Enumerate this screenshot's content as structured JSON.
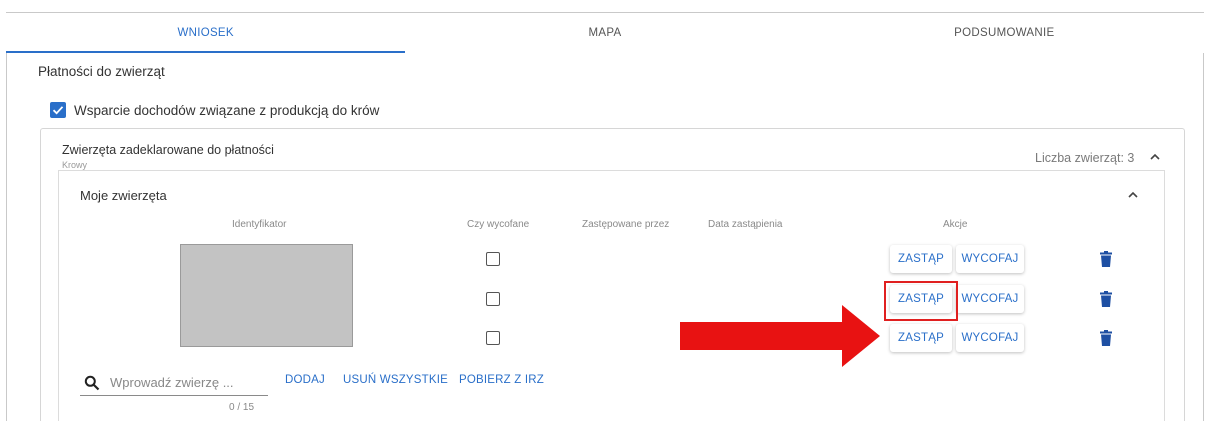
{
  "tabs": [
    {
      "label": "WNIOSEK",
      "active": true
    },
    {
      "label": "MAPA",
      "active": false
    },
    {
      "label": "PODSUMOWANIE",
      "active": false
    }
  ],
  "section": {
    "title": "Płatności do zwierząt"
  },
  "support_checkbox": {
    "label": "Wsparcie dochodów związane z produkcją do krów",
    "checked": true
  },
  "declared": {
    "title": "Zwierzęta zadeklarowane do płatności",
    "subtitle": "Krowy",
    "count_label": "Liczba zwierząt: 3"
  },
  "my_animals": {
    "title": "Moje zwierzęta",
    "columns": [
      "Identyfikator",
      "Czy wycofane",
      "Zastępowane przez",
      "Data zastąpienia",
      "Akcje"
    ],
    "rows": [
      {
        "withdrawn": false,
        "replace_label": "ZASTĄP",
        "withdraw_label": "WYCOFAJ"
      },
      {
        "withdrawn": false,
        "replace_label": "ZASTĄP",
        "withdraw_label": "WYCOFAJ"
      },
      {
        "withdrawn": false,
        "replace_label": "ZASTĄP",
        "withdraw_label": "WYCOFAJ"
      }
    ]
  },
  "search": {
    "placeholder": "Wprowadź zwierzę ...",
    "value": "",
    "counter": "0 / 15",
    "add_label": "DODAJ",
    "remove_all_label": "USUŃ WSZYSTKIE",
    "fetch_label": "POBIERZ Z IRZ"
  },
  "colors": {
    "accent": "#2a6fc9",
    "annotation": "#e02020"
  }
}
